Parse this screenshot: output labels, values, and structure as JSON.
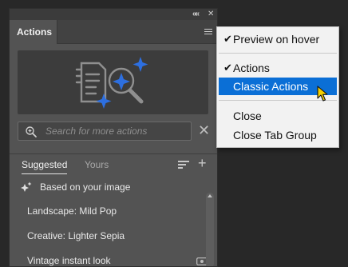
{
  "panel": {
    "tab_label": "Actions",
    "search": {
      "placeholder": "Search for more actions",
      "value": ""
    },
    "subtabs": [
      "Suggested",
      "Yours"
    ],
    "active_subtab": "Suggested",
    "list_header": "Based on your image",
    "items": [
      "Landscape: Mild Pop",
      "Creative: Lighter Sepia",
      "Vintage instant look"
    ]
  },
  "menu": {
    "items": [
      {
        "label": "Preview on hover",
        "checked": true
      },
      {
        "label": "Actions",
        "checked": true
      },
      {
        "label": "Classic Actions",
        "checked": false,
        "highlighted": true
      },
      {
        "label": "Close",
        "checked": false
      },
      {
        "label": "Close Tab Group",
        "checked": false
      }
    ]
  },
  "colors": {
    "panel_bg": "#535353",
    "menu_highlight": "#0B6FD6",
    "illustration_accent": "#2D6FE0"
  },
  "icons": [
    "collapse-icon",
    "close-icon",
    "panel-menu-icon",
    "search-sparkle-icon",
    "clear-icon",
    "list-view-icon",
    "add-icon",
    "sparkle-icon",
    "eye-icon",
    "checkmark-icon",
    "cursor-icon"
  ]
}
